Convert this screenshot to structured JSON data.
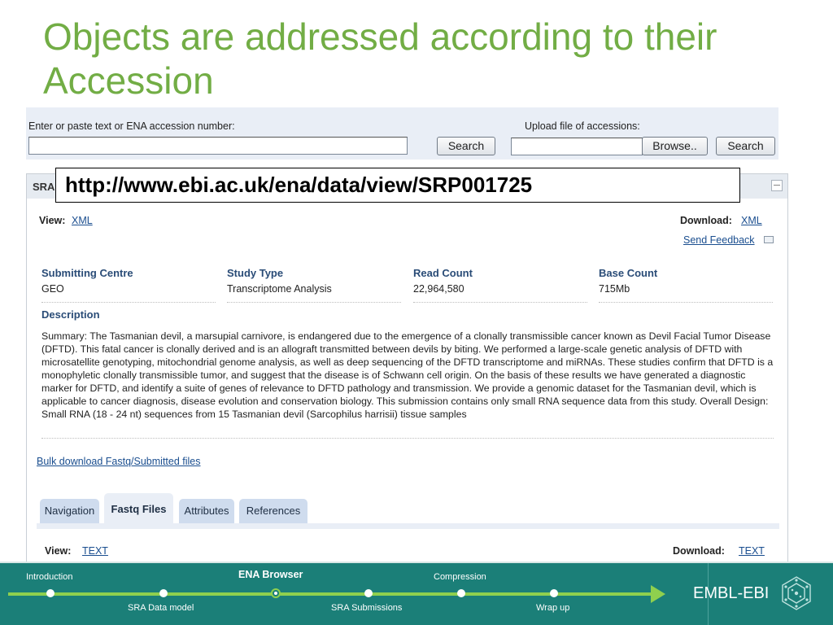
{
  "slide": {
    "title": "Objects are addressed according to their Accession",
    "url": "http://www.ebi.ac.uk/ena/data/view/SRP001725"
  },
  "search": {
    "accession_label": "Enter or paste text or ENA accession number:",
    "accession_value": "",
    "search_button": "Search",
    "upload_label": "Upload file of accessions:",
    "upload_value": "",
    "browse_button": "Browse..",
    "upload_search_button": "Search"
  },
  "record": {
    "header_label": "SRA",
    "view_label": "View:",
    "view_link": "XML",
    "download_label": "Download:",
    "download_link": "XML",
    "feedback_link": "Send Feedback",
    "fields": [
      {
        "label": "Submitting Centre",
        "value": "GEO"
      },
      {
        "label": "Study Type",
        "value": "Transcriptome Analysis"
      },
      {
        "label": "Read Count",
        "value": "22,964,580"
      },
      {
        "label": "Base Count",
        "value": "715Mb"
      }
    ],
    "description_label": "Description",
    "description": "Summary: The Tasmanian devil, a marsupial carnivore, is endangered due to the emergence of a clonally transmissible cancer known as Devil Facial Tumor Disease (DFTD). This fatal cancer is clonally derived and is an allograft transmitted between devils by biting. We performed a large-scale genetic analysis of DFTD with microsatellite genotyping, mitochondrial genome analysis, as well as deep sequencing of the DFTD transcriptome and miRNAs. These studies confirm that DFTD is a monophyletic clonally transmissible tumor, and suggest that the disease is of Schwann cell origin. On the basis of these results we have generated a diagnostic marker for DFTD, and identify a suite of genes of relevance to DFTD pathology and transmission. We provide a genomic dataset for the Tasmanian devil, which is applicable to cancer diagnosis, disease evolution and conservation biology. This submission contains only small RNA sequence data from this study. Overall Design: Small RNA (18 - 24 nt) sequences from 15 Tasmanian devil (Sarcophilus harrisii) tissue samples",
    "bulk_download_link": "Bulk download Fastq/Submitted files",
    "tabs": [
      {
        "label": "Navigation"
      },
      {
        "label": "Fastq Files"
      },
      {
        "label": "Attributes"
      },
      {
        "label": "References"
      }
    ],
    "active_tab": "Fastq Files",
    "tab_view_label": "View:",
    "tab_view_link": "TEXT",
    "tab_download_label": "Download:",
    "tab_download_link": "TEXT"
  },
  "footer": {
    "nav_items": [
      {
        "label": "Introduction"
      },
      {
        "label": "SRA Data model"
      },
      {
        "label": "ENA Browser"
      },
      {
        "label": "SRA Submissions"
      },
      {
        "label": "Compression"
      },
      {
        "label": "Wrap up"
      }
    ],
    "current": "ENA Browser",
    "logo_text": "EMBL-EBI",
    "colors": {
      "bar": "#1b7f78",
      "accent": "#8fd04e",
      "title": "#72ad45"
    }
  }
}
